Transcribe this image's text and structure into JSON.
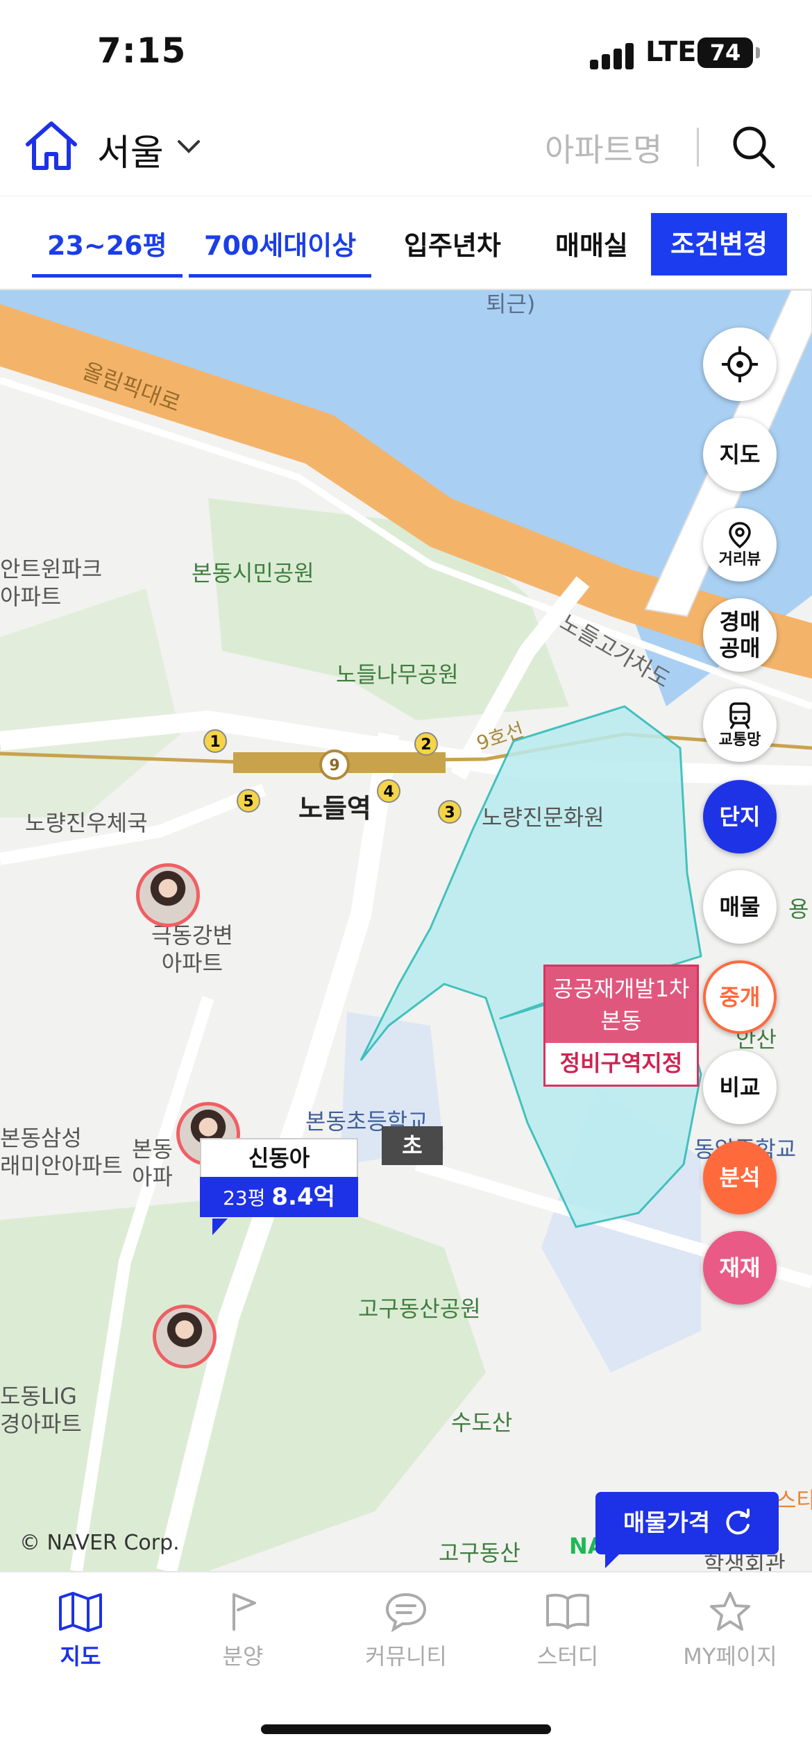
{
  "status_bar": {
    "time": "7:15",
    "network": "LTE",
    "battery": "74"
  },
  "header": {
    "region": "서울",
    "search_placeholder": "아파트명"
  },
  "filters": {
    "chips": [
      {
        "label": "23~26평",
        "active": true
      },
      {
        "label": "700세대이상",
        "active": true
      },
      {
        "label": "입주년차",
        "active": false
      },
      {
        "label": "매매실",
        "active": false
      }
    ],
    "change_button": "조건변경"
  },
  "map": {
    "labels": {
      "olympic_road": "올림픽대로",
      "bondong_park": "본동시민공원",
      "nodeul_namu_park": "노들나무공원",
      "nodeul_overpass": "노들고가차도",
      "line9": "9호선",
      "nodeul_station": "노들역",
      "noryangjin_post": "노량진우체국",
      "noryangjin_culture": "노량진문화원",
      "twinpark": "안트윈파크\n아파트",
      "geukdong": "극동강변\n아파트",
      "bondong_samsung": "본동삼성\n래미안아파트",
      "bondong_apt": "본동\n아파",
      "bondong_school": "본동초등학교",
      "gogu_park": "고구동산공원",
      "sudosan": "수도산",
      "gogudongsan": "고구동산",
      "lig": "도동LIG\n경아파트",
      "dongak_school": "동양중학교",
      "yong": "용",
      "an": "안산",
      "hakseng": "학생회관",
      "sta": "스타",
      "naver": "NA",
      "tgeoli": "퇴근)"
    },
    "exits": [
      "1",
      "2",
      "3",
      "4",
      "5",
      "9"
    ],
    "redevelopment": {
      "title": "공공재개발1차\n본동",
      "status": "정비구역지정"
    },
    "school_tag": "초",
    "apartment_card": {
      "name": "신동아",
      "size": "23평",
      "price": "8.4억"
    },
    "price_button": "매물가격",
    "copyright": "© NAVER Corp."
  },
  "side_buttons": {
    "location": "",
    "map": "지도",
    "street_view": "거리뷰",
    "auction": "경매\n공매",
    "transit": "교통망",
    "complex": "단지",
    "listing": "매물",
    "broker": "중개",
    "compare": "비교",
    "analysis": "분석",
    "rebuild": "재재"
  },
  "bottom_nav": [
    {
      "label": "지도",
      "icon": "map-icon",
      "active": true
    },
    {
      "label": "분양",
      "icon": "flag-icon",
      "active": false
    },
    {
      "label": "커뮤니티",
      "icon": "chat-icon",
      "active": false
    },
    {
      "label": "스터디",
      "icon": "book-icon",
      "active": false
    },
    {
      "label": "MY페이지",
      "icon": "star-icon",
      "active": false
    }
  ],
  "colors": {
    "accent": "#1d31e6",
    "analysis": "#ff6a3d",
    "rebuild": "#ea5a86",
    "redevelopment": "#e0577d",
    "river": "#a9d0f3",
    "road": "#f3b46a"
  }
}
